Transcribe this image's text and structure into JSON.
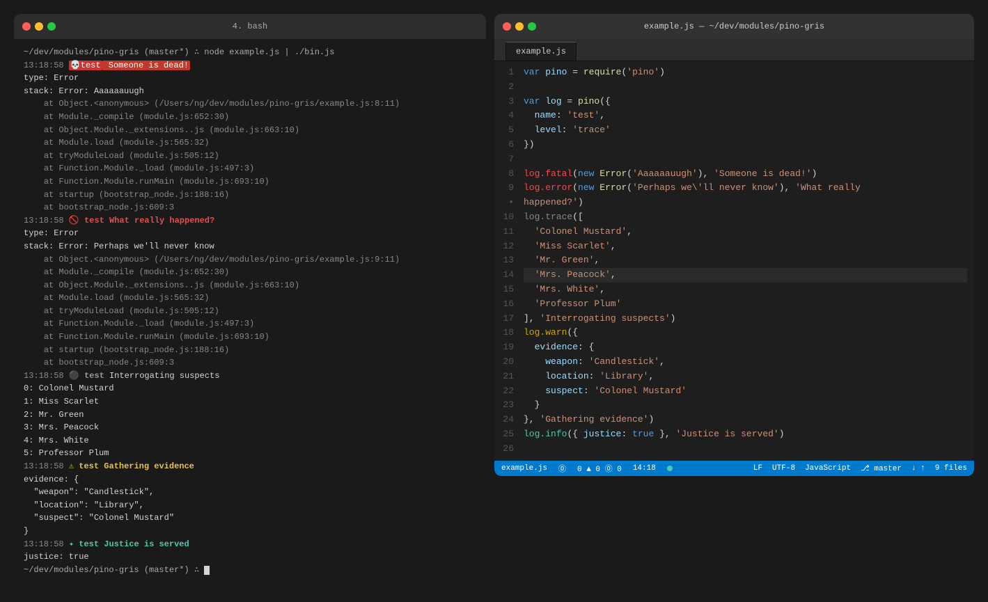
{
  "terminal": {
    "title": "4. bash",
    "dots": [
      "red",
      "yellow",
      "green"
    ],
    "lines": [
      {
        "type": "prompt",
        "text": "~/dev/modules/pino-gris (master*) ∴ node example.js | ./bin.js"
      },
      {
        "type": "fatal-line",
        "ts": "13:18:58",
        "icon": "💀",
        "badge": "test",
        "msg": " Someone is dead!"
      },
      {
        "type": "plain",
        "text": "type: Error"
      },
      {
        "type": "plain",
        "text": "stack: Error: Aaaaaauugh"
      },
      {
        "type": "gray",
        "text": "    at Object.<anonymous> (/Users/ng/dev/modules/pino-gris/example.js:8:11)"
      },
      {
        "type": "gray",
        "text": "    at Module._compile (module.js:652:30)"
      },
      {
        "type": "gray",
        "text": "    at Object.Module._extensions..js (module.js:663:10)"
      },
      {
        "type": "gray",
        "text": "    at Module.load (module.js:565:32)"
      },
      {
        "type": "gray",
        "text": "    at tryModuleLoad (module.js:505:12)"
      },
      {
        "type": "gray",
        "text": "    at Function.Module._load (module.js:497:3)"
      },
      {
        "type": "gray",
        "text": "    at Function.Module.runMain (module.js:693:10)"
      },
      {
        "type": "gray",
        "text": "    at startup (bootstrap_node.js:188:16)"
      },
      {
        "type": "gray",
        "text": "    at bootstrap_node.js:609:3"
      },
      {
        "type": "error-line",
        "ts": "13:18:58",
        "icon": "🚫",
        "badge": "test",
        "msg": " What really happened?"
      },
      {
        "type": "plain",
        "text": "type: Error"
      },
      {
        "type": "plain",
        "text": "stack: Error: Perhaps we'll never know"
      },
      {
        "type": "gray",
        "text": "    at Object.<anonymous> (/Users/ng/dev/modules/pino-gris/example.js:9:11)"
      },
      {
        "type": "gray",
        "text": "    at Module._compile (module.js:652:30)"
      },
      {
        "type": "gray",
        "text": "    at Object.Module._extensions..js (module.js:663:10)"
      },
      {
        "type": "gray",
        "text": "    at Module.load (module.js:565:32)"
      },
      {
        "type": "gray",
        "text": "    at tryModuleLoad (module.js:505:12)"
      },
      {
        "type": "gray",
        "text": "    at Function.Module._load (module.js:497:3)"
      },
      {
        "type": "gray",
        "text": "    at Function.Module.runMain (module.js:693:10)"
      },
      {
        "type": "gray",
        "text": "    at startup (bootstrap_node.js:188:16)"
      },
      {
        "type": "gray",
        "text": "    at bootstrap_node.js:609:3"
      },
      {
        "type": "trace-line",
        "ts": "13:18:58",
        "icon": "⚫",
        "badge": "test",
        "msg": " Interrogating suspects"
      },
      {
        "type": "plain",
        "text": "0: Colonel Mustard"
      },
      {
        "type": "plain",
        "text": "1: Miss Scarlet"
      },
      {
        "type": "plain",
        "text": "2: Mr. Green"
      },
      {
        "type": "plain",
        "text": "3: Mrs. Peacock"
      },
      {
        "type": "plain",
        "text": "4: Mrs. White"
      },
      {
        "type": "plain",
        "text": "5: Professor Plum"
      },
      {
        "type": "warn-line",
        "ts": "13:18:58",
        "icon": "⚠",
        "badge": "test",
        "msg": " Gathering evidence"
      },
      {
        "type": "plain",
        "text": "evidence: {"
      },
      {
        "type": "plain",
        "text": "  \"weapon\": \"Candlestick\","
      },
      {
        "type": "plain",
        "text": "  \"location\": \"Library\","
      },
      {
        "type": "plain",
        "text": "  \"suspect\": \"Colonel Mustard\""
      },
      {
        "type": "plain",
        "text": "}"
      },
      {
        "type": "info-line",
        "ts": "13:18:58",
        "icon": "✦",
        "badge": "test",
        "msg": " Justice is served"
      },
      {
        "type": "plain",
        "text": "justice: true"
      },
      {
        "type": "prompt-end",
        "text": "~/dev/modules/pino-gris (master*) ∴ "
      }
    ]
  },
  "editor": {
    "window_title": "example.js — ~/dev/modules/pino-gris",
    "tab_label": "example.js",
    "lines": [
      {
        "n": 1,
        "tokens": [
          {
            "c": "kw",
            "t": "var"
          },
          {
            "c": "pun",
            "t": " "
          },
          {
            "c": "var",
            "t": "pino"
          },
          {
            "c": "pun",
            "t": " = "
          },
          {
            "c": "fn",
            "t": "require"
          },
          {
            "c": "pun",
            "t": "("
          },
          {
            "c": "str",
            "t": "'pino'"
          },
          {
            "c": "pun",
            "t": ")"
          }
        ]
      },
      {
        "n": 2,
        "tokens": []
      },
      {
        "n": 3,
        "tokens": [
          {
            "c": "kw",
            "t": "var"
          },
          {
            "c": "pun",
            "t": " "
          },
          {
            "c": "var",
            "t": "log"
          },
          {
            "c": "pun",
            "t": " = "
          },
          {
            "c": "fn",
            "t": "pino"
          },
          {
            "c": "pun",
            "t": "({"
          }
        ]
      },
      {
        "n": 4,
        "tokens": [
          {
            "c": "pun",
            "t": "  "
          },
          {
            "c": "prop",
            "t": "name"
          },
          {
            "c": "pun",
            "t": ": "
          },
          {
            "c": "str",
            "t": "'test'"
          },
          {
            "c": "pun",
            "t": ","
          }
        ]
      },
      {
        "n": 5,
        "tokens": [
          {
            "c": "pun",
            "t": "  "
          },
          {
            "c": "prop",
            "t": "level"
          },
          {
            "c": "pun",
            "t": ": "
          },
          {
            "c": "str",
            "t": "'trace'"
          }
        ]
      },
      {
        "n": 6,
        "tokens": [
          {
            "c": "pun",
            "t": "})"
          }
        ]
      },
      {
        "n": 7,
        "tokens": []
      },
      {
        "n": 8,
        "tokens": [
          {
            "c": "log-fatal",
            "t": "log"
          },
          {
            "c": "log-fatal",
            "t": "."
          },
          {
            "c": "log-fatal",
            "t": "fatal"
          },
          {
            "c": "pun",
            "t": "("
          },
          {
            "c": "kw",
            "t": "new"
          },
          {
            "c": "pun",
            "t": " "
          },
          {
            "c": "fn",
            "t": "Error"
          },
          {
            "c": "pun",
            "t": "("
          },
          {
            "c": "str",
            "t": "'Aaaaaauugh'"
          },
          {
            "c": "pun",
            "t": "), "
          },
          {
            "c": "str",
            "t": "'Someone is dead!'"
          },
          {
            "c": "pun",
            "t": ")"
          }
        ]
      },
      {
        "n": 9,
        "tokens": [
          {
            "c": "log-error",
            "t": "log"
          },
          {
            "c": "log-error",
            "t": "."
          },
          {
            "c": "log-error",
            "t": "error"
          },
          {
            "c": "pun",
            "t": "("
          },
          {
            "c": "kw",
            "t": "new"
          },
          {
            "c": "pun",
            "t": " "
          },
          {
            "c": "fn",
            "t": "Error"
          },
          {
            "c": "pun",
            "t": "("
          },
          {
            "c": "str",
            "t": "'Perhaps we\\'ll never know'"
          },
          {
            "c": "pun",
            "t": "), "
          },
          {
            "c": "str",
            "t": "'What really"
          },
          {
            "c": "pun",
            "t": ""
          }
        ]
      },
      {
        "n": "•",
        "tokens": [
          {
            "c": "str",
            "t": "happened?'"
          },
          {
            "c": "pun",
            "t": ")"
          }
        ]
      },
      {
        "n": 10,
        "tokens": [
          {
            "c": "log-trace",
            "t": "log"
          },
          {
            "c": "log-trace",
            "t": "."
          },
          {
            "c": "log-trace",
            "t": "trace"
          },
          {
            "c": "pun",
            "t": "(["
          }
        ]
      },
      {
        "n": 11,
        "tokens": [
          {
            "c": "pun",
            "t": "  "
          },
          {
            "c": "str",
            "t": "'Colonel Mustard'"
          },
          {
            "c": "pun",
            "t": ","
          }
        ]
      },
      {
        "n": 12,
        "tokens": [
          {
            "c": "pun",
            "t": "  "
          },
          {
            "c": "str",
            "t": "'Miss Scarlet'"
          },
          {
            "c": "pun",
            "t": ","
          }
        ]
      },
      {
        "n": 13,
        "tokens": [
          {
            "c": "pun",
            "t": "  "
          },
          {
            "c": "str",
            "t": "'Mr. Green'"
          },
          {
            "c": "pun",
            "t": ","
          }
        ]
      },
      {
        "n": 14,
        "tokens": [
          {
            "c": "pun",
            "t": "  "
          },
          {
            "c": "str",
            "t": "'Mrs. Peacock'"
          },
          {
            "c": "pun",
            "t": ","
          }
        ],
        "highlight": true
      },
      {
        "n": 15,
        "tokens": [
          {
            "c": "pun",
            "t": "  "
          },
          {
            "c": "str",
            "t": "'Mrs. White'"
          },
          {
            "c": "pun",
            "t": ","
          }
        ]
      },
      {
        "n": 16,
        "tokens": [
          {
            "c": "pun",
            "t": "  "
          },
          {
            "c": "str",
            "t": "'Professor Plum'"
          }
        ]
      },
      {
        "n": 17,
        "tokens": [
          {
            "c": "pun",
            "t": "], "
          },
          {
            "c": "str",
            "t": "'Interrogating suspects'"
          },
          {
            "c": "pun",
            "t": ")"
          }
        ]
      },
      {
        "n": 18,
        "tokens": [
          {
            "c": "log-warn",
            "t": "log"
          },
          {
            "c": "log-warn",
            "t": "."
          },
          {
            "c": "log-warn",
            "t": "warn"
          },
          {
            "c": "pun",
            "t": "({"
          }
        ]
      },
      {
        "n": 19,
        "tokens": [
          {
            "c": "pun",
            "t": "  "
          },
          {
            "c": "prop",
            "t": "evidence"
          },
          {
            "c": "pun",
            "t": ": {"
          }
        ]
      },
      {
        "n": 20,
        "tokens": [
          {
            "c": "pun",
            "t": "    "
          },
          {
            "c": "prop",
            "t": "weapon"
          },
          {
            "c": "pun",
            "t": ": "
          },
          {
            "c": "str",
            "t": "'Candlestick'"
          },
          {
            "c": "pun",
            "t": ","
          }
        ]
      },
      {
        "n": 21,
        "tokens": [
          {
            "c": "pun",
            "t": "    "
          },
          {
            "c": "prop",
            "t": "location"
          },
          {
            "c": "pun",
            "t": ": "
          },
          {
            "c": "str",
            "t": "'Library'"
          },
          {
            "c": "pun",
            "t": ","
          }
        ]
      },
      {
        "n": 22,
        "tokens": [
          {
            "c": "pun",
            "t": "    "
          },
          {
            "c": "prop",
            "t": "suspect"
          },
          {
            "c": "pun",
            "t": ": "
          },
          {
            "c": "str",
            "t": "'Colonel Mustard'"
          }
        ]
      },
      {
        "n": 23,
        "tokens": [
          {
            "c": "pun",
            "t": "  }"
          }
        ]
      },
      {
        "n": 24,
        "tokens": [
          {
            "c": "pun",
            "t": "}, "
          },
          {
            "c": "str",
            "t": "'Gathering evidence'"
          },
          {
            "c": "pun",
            "t": ")"
          }
        ]
      },
      {
        "n": 25,
        "tokens": [
          {
            "c": "log-info",
            "t": "log"
          },
          {
            "c": "log-info",
            "t": "."
          },
          {
            "c": "log-info",
            "t": "info"
          },
          {
            "c": "pun",
            "t": "({ "
          },
          {
            "c": "prop",
            "t": "justice"
          },
          {
            "c": "pun",
            "t": ": "
          },
          {
            "c": "bool",
            "t": "true"
          },
          {
            "c": "pun",
            "t": " }, "
          },
          {
            "c": "str",
            "t": "'Justice is served'"
          },
          {
            "c": "pun",
            "t": ")"
          }
        ]
      },
      {
        "n": 26,
        "tokens": []
      }
    ],
    "status": {
      "file": "example.js",
      "errors": "0",
      "warnings": "0",
      "info": "0",
      "line_col": "14:18",
      "encoding": "LF",
      "charset": "UTF-8",
      "lang": "JavaScript",
      "branch": "master",
      "files": "9 files"
    }
  }
}
